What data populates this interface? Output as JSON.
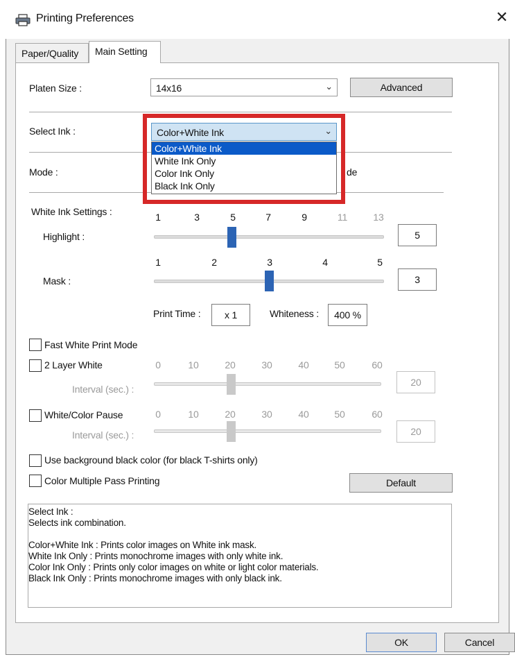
{
  "window": {
    "title": "Printing Preferences",
    "close_symbol": "✕"
  },
  "tabs": [
    {
      "label": "Paper/Quality"
    },
    {
      "label": "Main Setting"
    }
  ],
  "platen": {
    "label": "Platen Size :",
    "value": "14x16",
    "advanced_label": "Advanced"
  },
  "ink": {
    "label": "Select Ink :",
    "value": "Color+White Ink",
    "options": [
      "Color+White Ink",
      "White Ink Only",
      "Color Ink Only",
      "Black Ink Only"
    ]
  },
  "mode": {
    "label": "Mode :",
    "partial_text": "de"
  },
  "white_settings": {
    "label": "White Ink Settings :",
    "highlight": {
      "label": "Highlight :",
      "ticks": [
        "1",
        "3",
        "5",
        "7",
        "9",
        "11",
        "13"
      ],
      "value": "5",
      "min": 1,
      "max": 13,
      "level": 5
    },
    "mask": {
      "label": "Mask :",
      "ticks": [
        "1",
        "2",
        "3",
        "4",
        "5"
      ],
      "value": "3",
      "min": 1,
      "max": 5,
      "level": 3
    },
    "print_time_label": "Print Time :",
    "print_time_value": "x 1",
    "whiteness_label": "Whiteness :",
    "whiteness_value": "400 %"
  },
  "options": {
    "fast_white": "Fast White Print Mode",
    "two_layer": "2 Layer White",
    "white_color_pause": "White/Color Pause",
    "interval_label": "Interval (sec.) :",
    "interval_ticks": [
      "0",
      "10",
      "20",
      "30",
      "40",
      "50",
      "60"
    ],
    "two_layer_interval": "20",
    "pause_interval": "20",
    "two_layer_level": 20,
    "pause_level": 20,
    "background_black": "Use background black color (for black T-shirts only)",
    "color_multi_pass": "Color Multiple Pass Printing",
    "default_label": "Default"
  },
  "description": {
    "lines": [
      "Select Ink :",
      "Selects ink combination.",
      "",
      "Color+White Ink : Prints color images on White ink mask.",
      "White Ink Only : Prints monochrome images with only white ink.",
      "Color Ink Only : Prints only color images on white or light color materials.",
      "Black Ink Only : Prints monochrome images with only black ink."
    ]
  },
  "footer": {
    "ok_label": "OK",
    "cancel_label": "Cancel"
  },
  "colors": {
    "accent": "#d62828",
    "selection": "#0b5ac8",
    "slider_thumb": "#2c64b4"
  }
}
